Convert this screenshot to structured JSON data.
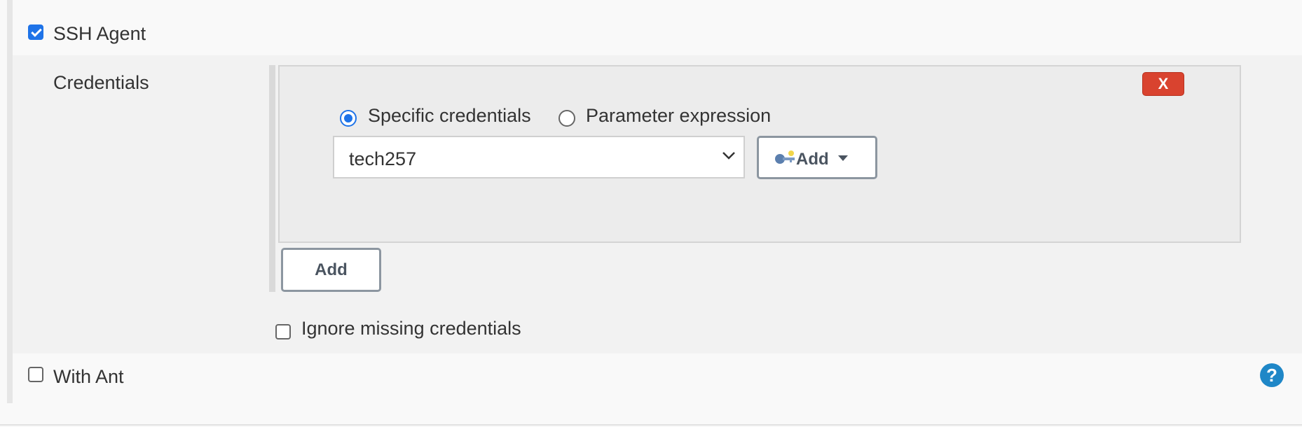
{
  "ssh_agent": {
    "label": "SSH Agent",
    "checked": true
  },
  "credentials": {
    "section_label": "Credentials",
    "remove_button_label": "X",
    "radio_specific_label": "Specific credentials",
    "radio_parameter_label": "Parameter expression",
    "selected_option": "Specific credentials",
    "select_value": "tech257",
    "add_menu_button_label": "Add",
    "add_button_label": "Add"
  },
  "ignore_missing": {
    "label": "Ignore missing credentials",
    "checked": false
  },
  "with_ant": {
    "label": "With Ant",
    "checked": false
  },
  "help": {
    "icon": "help-icon",
    "glyph": "?"
  },
  "colors": {
    "accent": "#1e73e8",
    "danger": "#d9432f",
    "help": "#1f87c7",
    "section_bg": "#f2f2f2",
    "box_bg": "#ececec"
  }
}
